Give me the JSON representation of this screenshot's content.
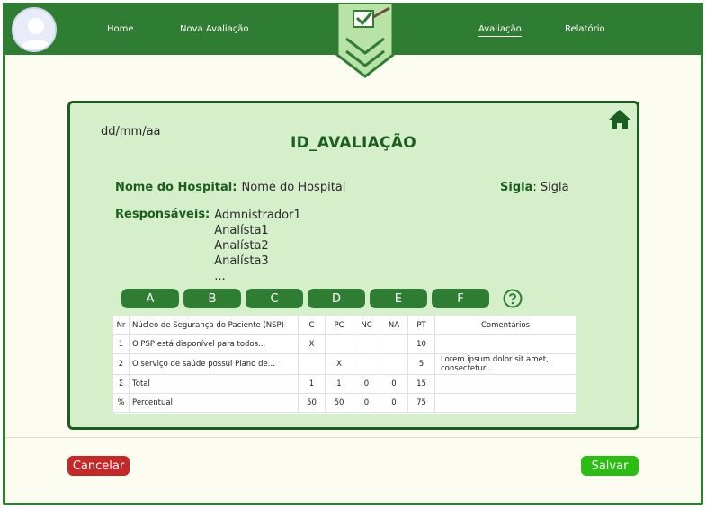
{
  "nav": {
    "home": "Home",
    "nova_avaliacao": "Nova Avaliação",
    "avaliacao": "Avaliação",
    "relatorio": "Relatório"
  },
  "card": {
    "date": "dd/mm/aa",
    "title": "ID_AVALIAÇÃO",
    "hospital_label": "Nome do Hospital:",
    "hospital_value": "Nome do Hospital",
    "sigla_label": "Sigla",
    "sigla_value": ": Sigla",
    "responsaveis_label": "Responsáveis:",
    "responsaveis": [
      "Admnistrador1",
      "Analísta1",
      "Analísta2",
      "Analísta3",
      "..."
    ]
  },
  "tabs": [
    "A",
    "B",
    "C",
    "D",
    "E",
    "F"
  ],
  "table": {
    "headers": [
      "Nr",
      "Núcleo de Segurança do Paciente (NSP)",
      "C",
      "PC",
      "NC",
      "NA",
      "PT",
      "Comentários"
    ],
    "rows": [
      [
        "1",
        "O PSP está disponível para todos...",
        "X",
        "",
        "",
        "",
        "10",
        ""
      ],
      [
        "2",
        "O serviço de saúde possui Plano de...",
        "",
        "X",
        "",
        "",
        "5",
        "Lorem ipsum dolor sit amet, consectetur..."
      ],
      [
        "Σ",
        "Total",
        "1",
        "1",
        "0",
        "0",
        "15",
        ""
      ],
      [
        "%",
        "Percentual",
        "50",
        "50",
        "0",
        "0",
        "75",
        ""
      ]
    ]
  },
  "footer": {
    "cancel": "Cancelar",
    "save": "Salvar"
  },
  "colors": {
    "primary": "#2e7d32",
    "card_bg": "#d4efc9",
    "cancel": "#c62828",
    "save": "#2bbd12"
  }
}
